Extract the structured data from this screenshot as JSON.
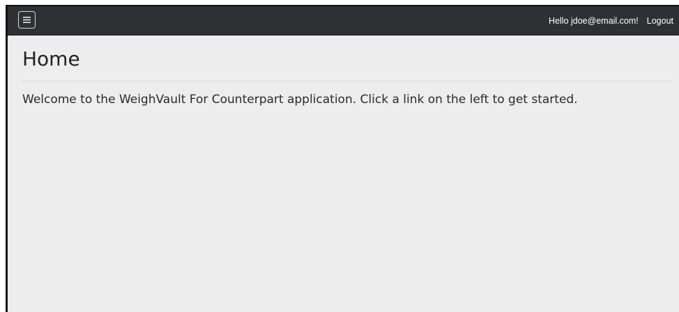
{
  "navbar": {
    "menu_icon": "hamburger-menu-icon",
    "greeting": "Hello jdoe@email.com!",
    "logout_label": "Logout",
    "background_color": "#2f3033"
  },
  "main": {
    "title": "Home",
    "welcome_text": "Welcome to the WeighVault For Counterpart application. Click a link on the left to get started.",
    "background_color": "#ededed"
  }
}
